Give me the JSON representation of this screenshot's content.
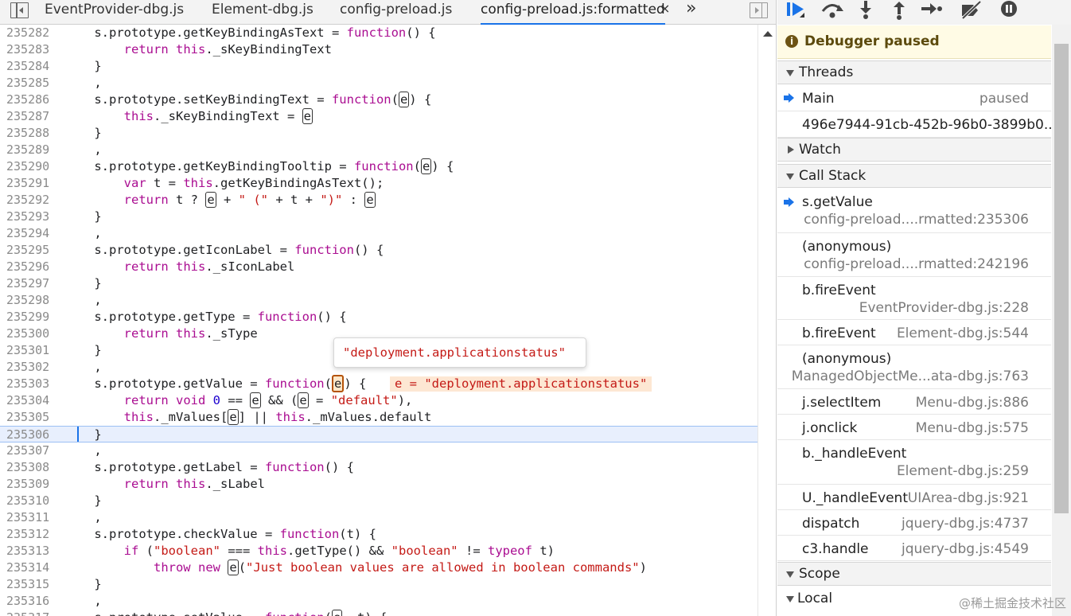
{
  "editor": {
    "tabs": [
      {
        "label": "EventProvider-dbg.js"
      },
      {
        "label": "Element-dbg.js"
      },
      {
        "label": "config-preload.js"
      },
      {
        "label": "config-preload.js:formatted"
      }
    ],
    "close_glyph": "×",
    "more_glyph": "»",
    "tooltip": "\"deployment.applicationstatus\"",
    "inline_value": "e = \"deployment.applicationstatus\"",
    "lines": [
      {
        "n": "235282",
        "code": "    s.prototype.getKeyBindingAsText = function() {"
      },
      {
        "n": "235283",
        "code": "        return this._sKeyBindingText"
      },
      {
        "n": "235284",
        "code": "    }"
      },
      {
        "n": "235285",
        "code": "    ,"
      },
      {
        "n": "235286",
        "code": "    s.prototype.setKeyBindingText = function(e) {"
      },
      {
        "n": "235287",
        "code": "        this._sKeyBindingText = e"
      },
      {
        "n": "235288",
        "code": "    }"
      },
      {
        "n": "235289",
        "code": "    ,"
      },
      {
        "n": "235290",
        "code": "    s.prototype.getKeyBindingTooltip = function(e) {"
      },
      {
        "n": "235291",
        "code": "        var t = this.getKeyBindingAsText();"
      },
      {
        "n": "235292",
        "code": "        return t ? e + \" (\" + t + \")\" : e"
      },
      {
        "n": "235293",
        "code": "    }"
      },
      {
        "n": "235294",
        "code": "    ,"
      },
      {
        "n": "235295",
        "code": "    s.prototype.getIconLabel = function() {"
      },
      {
        "n": "235296",
        "code": "        return this._sIconLabel"
      },
      {
        "n": "235297",
        "code": "    }"
      },
      {
        "n": "235298",
        "code": "    ,"
      },
      {
        "n": "235299",
        "code": "    s.prototype.getType = function() {"
      },
      {
        "n": "235300",
        "code": "        return this._sType"
      },
      {
        "n": "235301",
        "code": "    }"
      },
      {
        "n": "235302",
        "code": "    ,"
      },
      {
        "n": "235303",
        "code": "    s.prototype.getValue = function(e) {"
      },
      {
        "n": "235304",
        "code": "        return void 0 == e && (e = \"default\"),"
      },
      {
        "n": "235305",
        "code": "        this._mValues[e] || this._mValues.default"
      },
      {
        "n": "235306",
        "code": "    }"
      },
      {
        "n": "235307",
        "code": "    ,"
      },
      {
        "n": "235308",
        "code": "    s.prototype.getLabel = function() {"
      },
      {
        "n": "235309",
        "code": "        return this._sLabel"
      },
      {
        "n": "235310",
        "code": "    }"
      },
      {
        "n": "235311",
        "code": "    ,"
      },
      {
        "n": "235312",
        "code": "    s.prototype.checkValue = function(t) {"
      },
      {
        "n": "235313",
        "code": "        if (\"boolean\" === this.getType() && \"boolean\" != typeof t)"
      },
      {
        "n": "235314",
        "code": "            throw new e(\"Just boolean values are allowed in boolean commands\")"
      },
      {
        "n": "235315",
        "code": "    }"
      },
      {
        "n": "235316",
        "code": "    ,"
      },
      {
        "n": "235317",
        "code": "    s.prototype.setValue = function(e, t) {"
      }
    ]
  },
  "debugger": {
    "banner": "Debugger paused",
    "banner_icon": "info-icon",
    "threads": {
      "title": "Threads",
      "items": [
        {
          "name": "Main",
          "status": "paused"
        },
        {
          "name": "496e7944-91cb-452b-96b0-3899b0..."
        }
      ]
    },
    "watch": {
      "title": "Watch"
    },
    "call_stack": {
      "title": "Call Stack",
      "frames": [
        {
          "name": "s.getValue",
          "loc": "config-preload....rmatted:235306"
        },
        {
          "name": "(anonymous)",
          "loc": "config-preload....rmatted:242196"
        },
        {
          "name": "b.fireEvent",
          "loc": "EventProvider-dbg.js:228"
        },
        {
          "name": "b.fireEvent",
          "loc": "Element-dbg.js:544"
        },
        {
          "name": "(anonymous)",
          "loc": "ManagedObjectMe...ata-dbg.js:763"
        },
        {
          "name": "j.selectItem",
          "loc": "Menu-dbg.js:886"
        },
        {
          "name": "j.onclick",
          "loc": "Menu-dbg.js:575"
        },
        {
          "name": "b._handleEvent",
          "loc": "Element-dbg.js:259"
        },
        {
          "name": "U._handleEvent",
          "loc": "UIArea-dbg.js:921"
        },
        {
          "name": "dispatch",
          "loc": "jquery-dbg.js:4737"
        },
        {
          "name": "c3.handle",
          "loc": "jquery-dbg.js:4549"
        }
      ]
    },
    "scope": {
      "title": "Scope",
      "local": "Local"
    }
  },
  "watermark": "@稀土掘金技术社区",
  "colors": {
    "accent": "#1a73e8",
    "keyword": "#aa0d91",
    "string": "#c41a16",
    "number": "#1c00cf",
    "paused_bg": "#fffbe5"
  }
}
